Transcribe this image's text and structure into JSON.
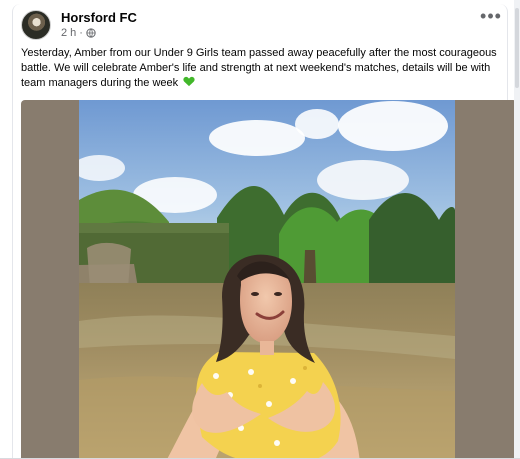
{
  "post": {
    "page_name": "Horsford FC",
    "timestamp": "2 h",
    "separator": "·",
    "privacy_icon": "globe-icon",
    "more_label": "•••",
    "text": "Yesterday, Amber from our Under 9 Girls team passed away peacefully after the most courageous battle. We will celebrate Amber's life and strength at next weekend's matches, details will be with team managers during the week",
    "emoji": "green-heart-icon"
  },
  "colors": {
    "text_primary": "#050505",
    "text_secondary": "#65676b",
    "photo_border": "#887c6e",
    "sky": "#a8c3df",
    "heart": "#42b72a"
  }
}
